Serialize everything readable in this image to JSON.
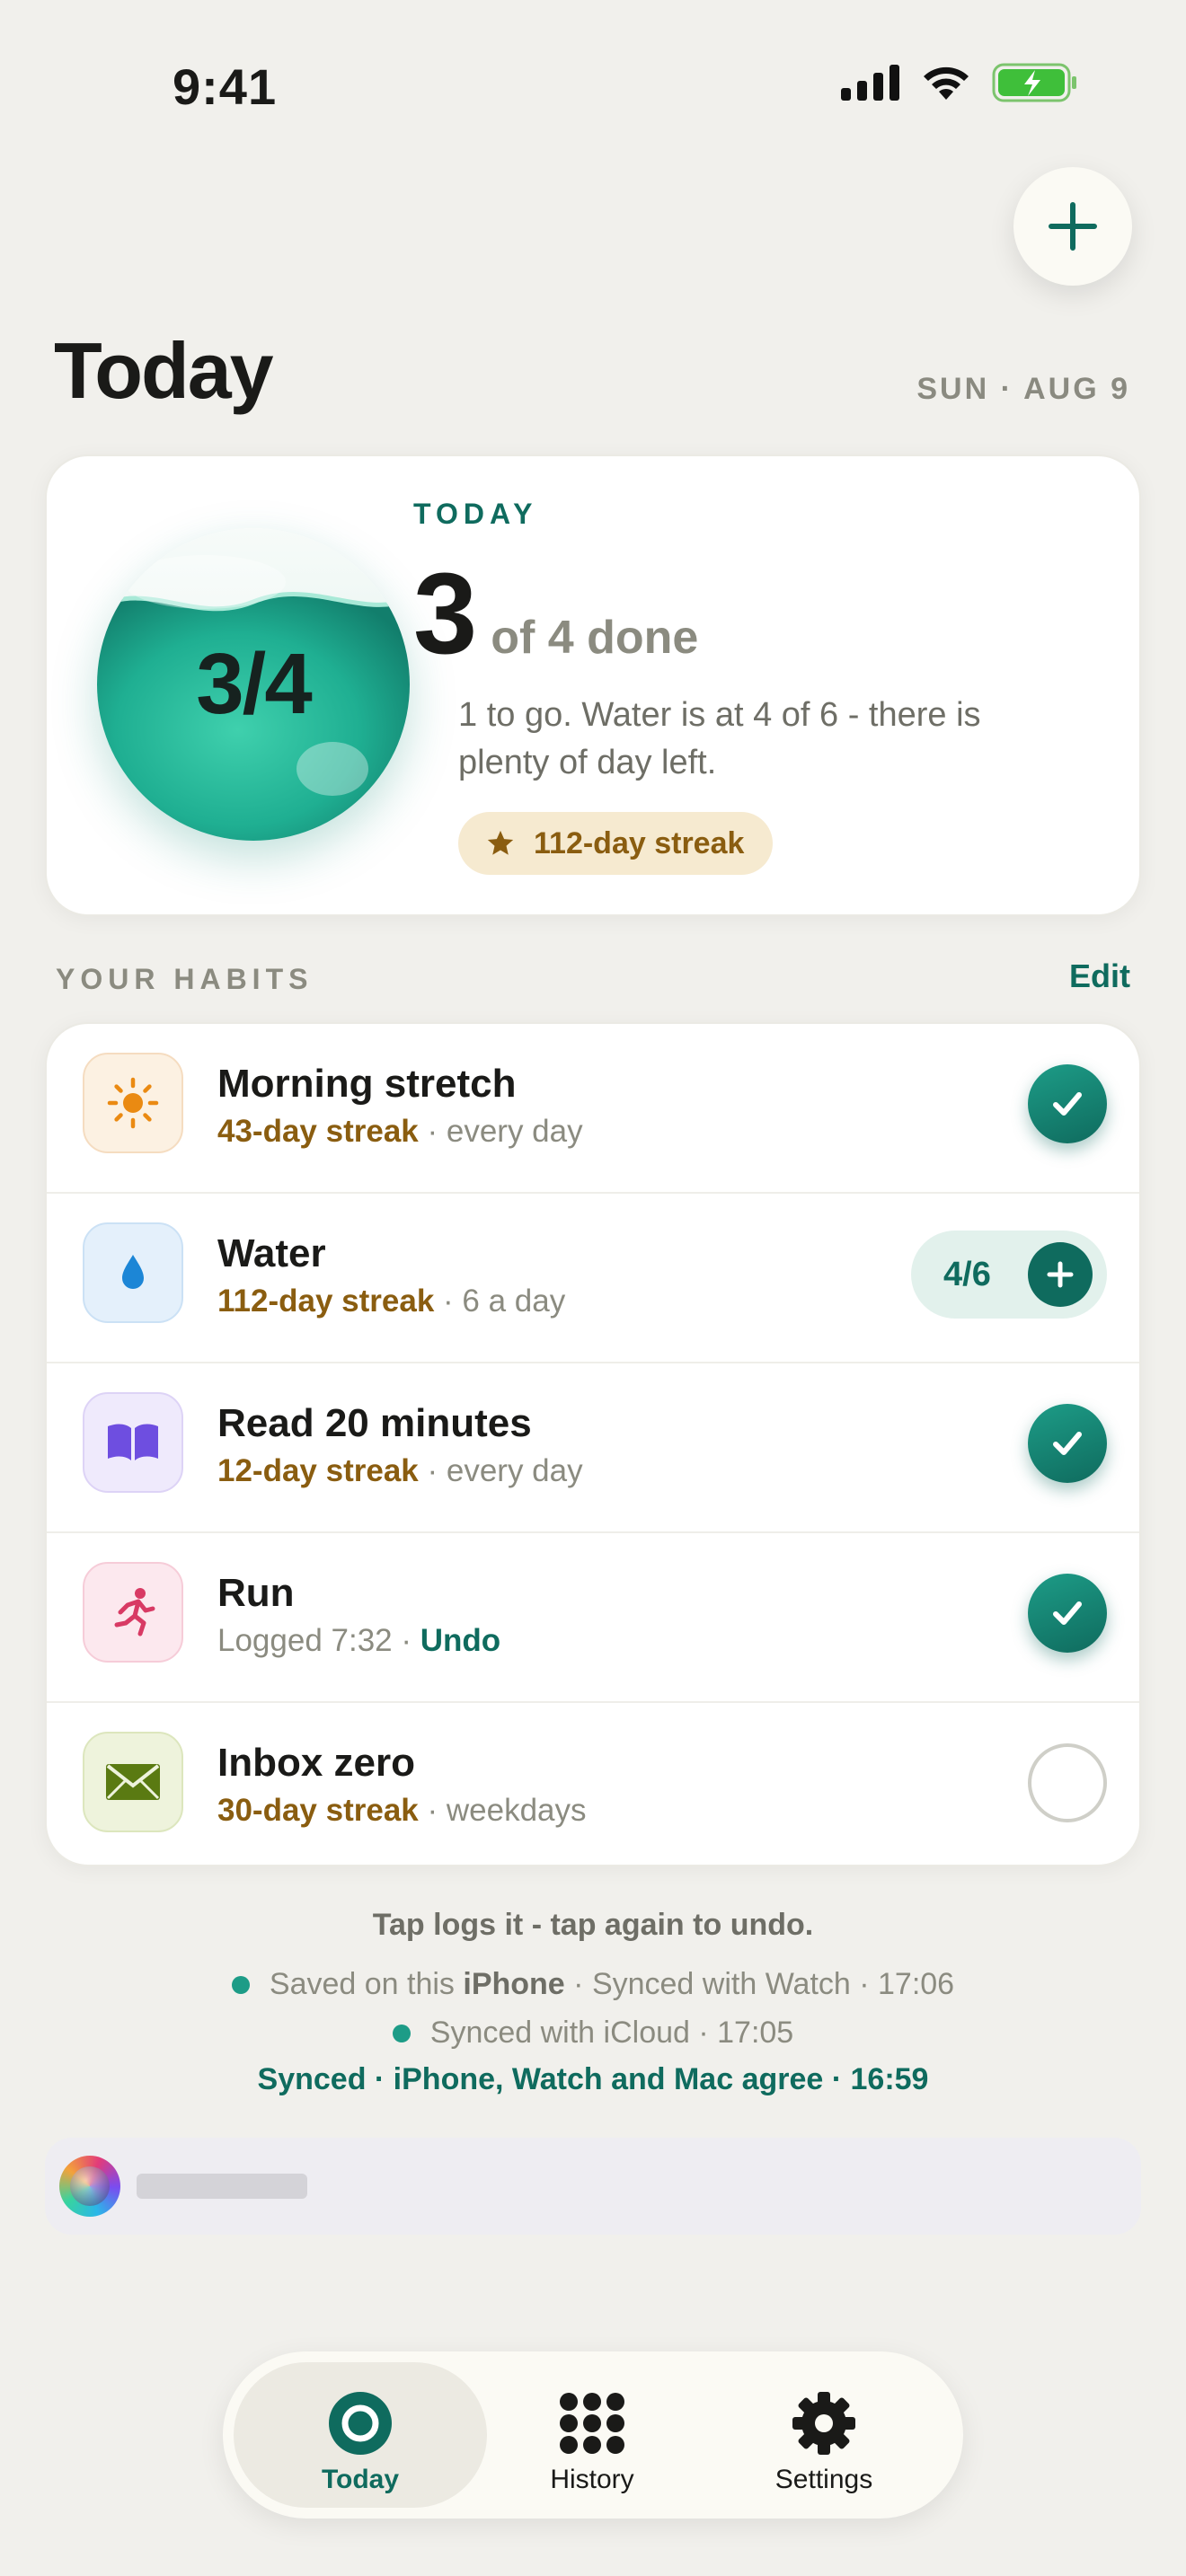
{
  "status_bar": {
    "time": "9:41",
    "icons": [
      "cellular-signal-icon",
      "wifi-icon",
      "battery-charging-icon"
    ]
  },
  "header": {
    "add_icon": "plus-icon",
    "title": "Today",
    "date": "SUN · AUG 9"
  },
  "summary": {
    "orb_label": "3/4",
    "completed_fraction": 0.75,
    "kicker": "TODAY",
    "done_count": "3",
    "done_suffix": "of 4 done",
    "note": "1 to go. Water is at 4 of 6 - there is plenty of day left.",
    "streak": "112-day streak",
    "streak_icon": "star-icon"
  },
  "habits_section": {
    "label": "YOUR HABITS",
    "edit": "Edit"
  },
  "habits": [
    {
      "name": "Morning stretch",
      "streak": "43-day streak",
      "meta": " · every day",
      "icon": "sun-icon",
      "state": "done"
    },
    {
      "name": "Water",
      "streak": "112-day streak",
      "meta": " · 6 a day",
      "icon": "water-drop-icon",
      "state": "counter",
      "counter": "4/6"
    },
    {
      "name": "Read 20 minutes",
      "streak": "12-day streak",
      "meta": " · every day",
      "icon": "book-icon",
      "state": "done"
    },
    {
      "name": "Run",
      "logged": "Logged 7:32 · ",
      "undo": "Undo",
      "icon": "runner-icon",
      "state": "done"
    },
    {
      "name": "Inbox zero",
      "streak": "30-day streak",
      "meta": " · weekdays",
      "icon": "envelope-icon",
      "state": "empty"
    }
  ],
  "colors": {
    "accent": "#0f6b5e",
    "accent_light": "#1d9c87",
    "streak": "#8a5d10",
    "background": "#f1f0ec"
  },
  "footer": {
    "hint": "Tap logs it - tap again to undo.",
    "sync_1_prefix": "Saved on this",
    "sync_1_device": "iPhone",
    "sync_1_suffix": "· Synced with Watch · 17:06",
    "sync_2": "Synced with iCloud · 17:05",
    "sync_3": "Synced · iPhone, Watch and Mac agree · 16:59"
  },
  "tabs": [
    {
      "label": "Today",
      "icon": "ring-icon",
      "active": true
    },
    {
      "label": "History",
      "icon": "grid-dots-icon",
      "active": false
    },
    {
      "label": "Settings",
      "icon": "gear-icon",
      "active": false
    }
  ]
}
